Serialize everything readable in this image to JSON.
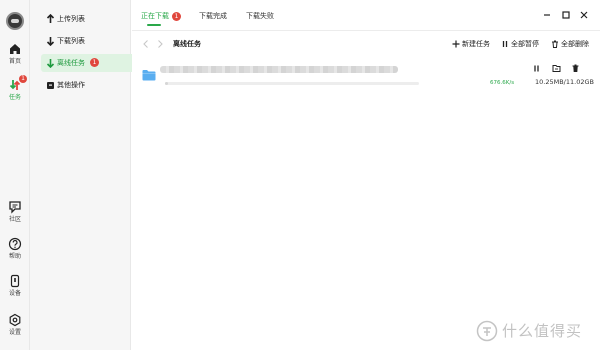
{
  "rail": {
    "items": [
      {
        "label": "首页",
        "icon": "home-icon"
      },
      {
        "label": "任务",
        "icon": "transfer-icon",
        "badge": "1"
      },
      {
        "label": "社区",
        "icon": "chat-icon"
      },
      {
        "label": "帮助",
        "icon": "help-icon"
      },
      {
        "label": "设备",
        "icon": "device-icon"
      },
      {
        "label": "设置",
        "icon": "settings-icon"
      }
    ]
  },
  "sidebar": {
    "items": [
      {
        "label": "上传列表",
        "icon": "arrow-up-icon"
      },
      {
        "label": "下载列表",
        "icon": "arrow-down-icon"
      },
      {
        "label": "离线任务",
        "icon": "arrow-down-icon",
        "badge": "1"
      },
      {
        "label": "其他操作",
        "icon": "toolbox-icon"
      }
    ]
  },
  "tabs": [
    {
      "label": "正在下载",
      "badge": "1"
    },
    {
      "label": "下载完成"
    },
    {
      "label": "下载失败"
    }
  ],
  "toolbar": {
    "folder": "离线任务",
    "new_task": "新建任务",
    "pause_all": "全部暂停",
    "delete_all": "全部删除"
  },
  "task": {
    "speed": "676.6K/s",
    "size": "10.25MB/11.02GB",
    "progress": 0.001
  },
  "watermark": {
    "text": "什么值得买"
  },
  "colors": {
    "accent": "#2aa84a",
    "badge": "#e0473d",
    "folder": "#5aaef0"
  }
}
